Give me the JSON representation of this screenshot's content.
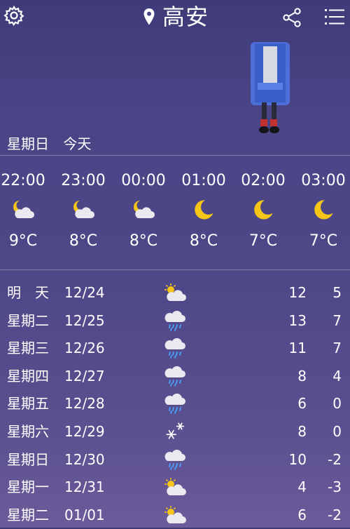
{
  "header": {
    "city": "高安",
    "settings_icon": "gear-icon",
    "location_icon": "location-pin-icon",
    "share_icon": "share-icon",
    "menu_icon": "menu-icon"
  },
  "today": {
    "weekday": "星期日",
    "label": "今天"
  },
  "hourly": [
    {
      "time": "22:00",
      "icon": "partly-cloudy-night-icon",
      "temp": "9°C"
    },
    {
      "time": "23:00",
      "icon": "partly-cloudy-night-icon",
      "temp": "8°C"
    },
    {
      "time": "00:00",
      "icon": "partly-cloudy-night-icon",
      "temp": "8°C"
    },
    {
      "time": "01:00",
      "icon": "moon-icon",
      "temp": "8°C"
    },
    {
      "time": "02:00",
      "icon": "moon-icon",
      "temp": "7°C"
    },
    {
      "time": "03:00",
      "icon": "moon-icon",
      "temp": "7°C"
    }
  ],
  "daily": [
    {
      "day": "明　天",
      "date": "12/24",
      "icon": "partly-cloudy-icon",
      "high": "12",
      "low": "5"
    },
    {
      "day": "星期二",
      "date": "12/25",
      "icon": "rain-icon",
      "high": "13",
      "low": "7"
    },
    {
      "day": "星期三",
      "date": "12/26",
      "icon": "rain-icon",
      "high": "11",
      "low": "7"
    },
    {
      "day": "星期四",
      "date": "12/27",
      "icon": "rain-icon",
      "high": "8",
      "low": "4"
    },
    {
      "day": "星期五",
      "date": "12/28",
      "icon": "rain-icon",
      "high": "6",
      "low": "0"
    },
    {
      "day": "星期六",
      "date": "12/29",
      "icon": "snow-icon",
      "high": "8",
      "low": "0"
    },
    {
      "day": "星期日",
      "date": "12/30",
      "icon": "rain-icon",
      "high": "10",
      "low": "-2"
    },
    {
      "day": "星期一",
      "date": "12/31",
      "icon": "partly-cloudy-icon",
      "high": "4",
      "low": "-3"
    },
    {
      "day": "星期二",
      "date": "01/01",
      "icon": "partly-cloudy-icon",
      "high": "6",
      "low": "-2"
    }
  ],
  "colors": {
    "sun": "#f5c518",
    "moon": "#f5c518",
    "cloud": "#e9e9ef",
    "rain": "#4aa3ff"
  }
}
